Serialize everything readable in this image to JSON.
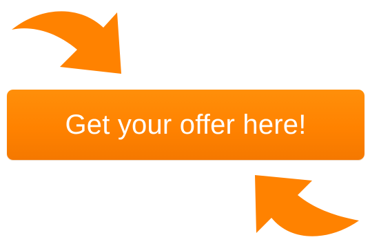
{
  "cta": {
    "label": "Get your offer here!"
  },
  "icons": {
    "top": "curved-arrow-down-right-icon",
    "bottom": "curved-arrow-up-left-icon"
  },
  "colors": {
    "accent": "#ff8200",
    "accent_dark": "#f47800",
    "text": "#ffffff",
    "background": "#ffffff"
  }
}
